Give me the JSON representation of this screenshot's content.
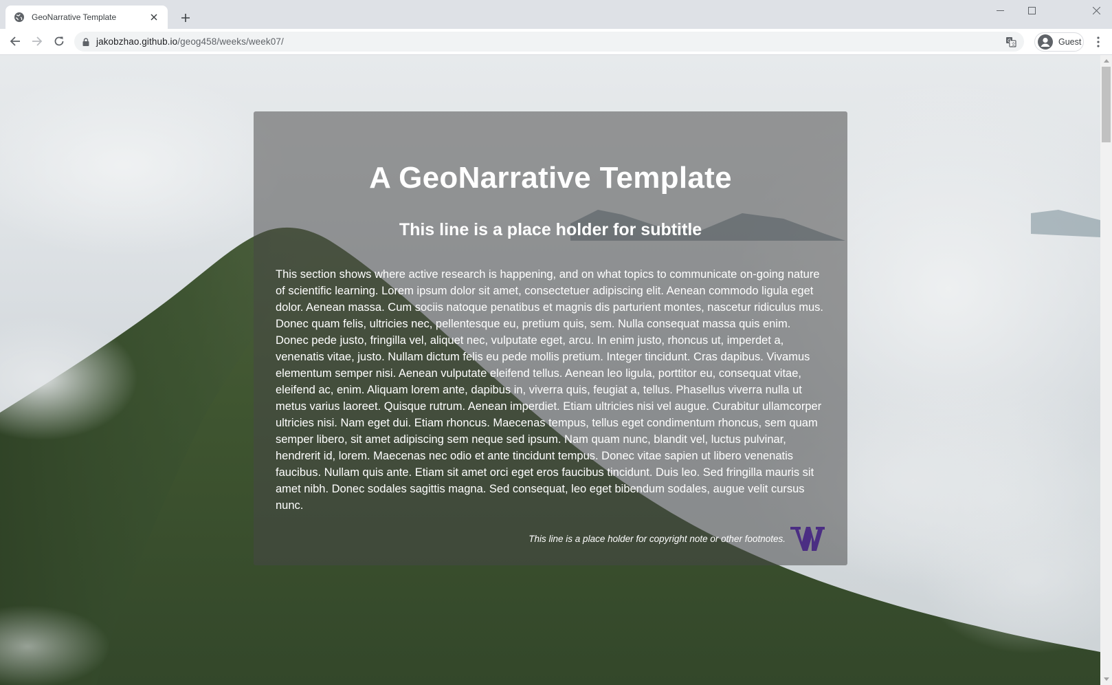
{
  "browser": {
    "tab_title": "GeoNarrative Template",
    "url_host": "jakobzhao.github.io",
    "url_path": "/geog458/weeks/week07/",
    "profile_label": "Guest"
  },
  "page": {
    "title": "A GeoNarrative Template",
    "subtitle": "This line is a place holder for subtitle",
    "body": "This section shows where active research is happening, and on what topics to communicate on-going nature of scientific learning. Lorem ipsum dolor sit amet, consectetuer adipiscing elit. Aenean commodo ligula eget dolor. Aenean massa. Cum sociis natoque penatibus et magnis dis parturient montes, nascetur ridiculus mus. Donec quam felis, ultricies nec, pellentesque eu, pretium quis, sem. Nulla consequat massa quis enim. Donec pede justo, fringilla vel, aliquet nec, vulputate eget, arcu. In enim justo, rhoncus ut, imperdet a, venenatis vitae, justo. Nullam dictum felis eu pede mollis pretium. Integer tincidunt. Cras dapibus. Vivamus elementum semper nisi. Aenean vulputate eleifend tellus. Aenean leo ligula, porttitor eu, consequat vitae, eleifend ac, enim. Aliquam lorem ante, dapibus in, viverra quis, feugiat a, tellus. Phasellus viverra nulla ut metus varius laoreet. Quisque rutrum. Aenean imperdiet. Etiam ultricies nisi vel augue. Curabitur ullamcorper ultricies nisi. Nam eget dui. Etiam rhoncus. Maecenas tempus, tellus eget condimentum rhoncus, sem quam semper libero, sit amet adipiscing sem neque sed ipsum. Nam quam nunc, blandit vel, luctus pulvinar, hendrerit id, lorem. Maecenas nec odio et ante tincidunt tempus. Donec vitae sapien ut libero venenatis faucibus. Nullam quis ante. Etiam sit amet orci eget eros faucibus tincidunt. Duis leo. Sed fringilla mauris sit amet nibh. Donec sodales sagittis magna. Sed consequat, leo eget bibendum sodales, augue velit cursus nunc.",
    "footnote": "This line is a place holder for copyright note or other footnotes.",
    "logo_letter": "W"
  },
  "colors": {
    "uw_purple": "#4b2e83",
    "card_overlay": "rgba(70,70,70,0.52)",
    "text": "#ffffff"
  },
  "icons": [
    "globe-icon",
    "close-icon",
    "plus-icon",
    "minimize-icon",
    "maximize-icon",
    "window-close-icon",
    "back-arrow-icon",
    "forward-arrow-icon",
    "reload-icon",
    "lock-icon",
    "translate-icon",
    "avatar-icon",
    "kebab-menu-icon",
    "uw-logo"
  ]
}
